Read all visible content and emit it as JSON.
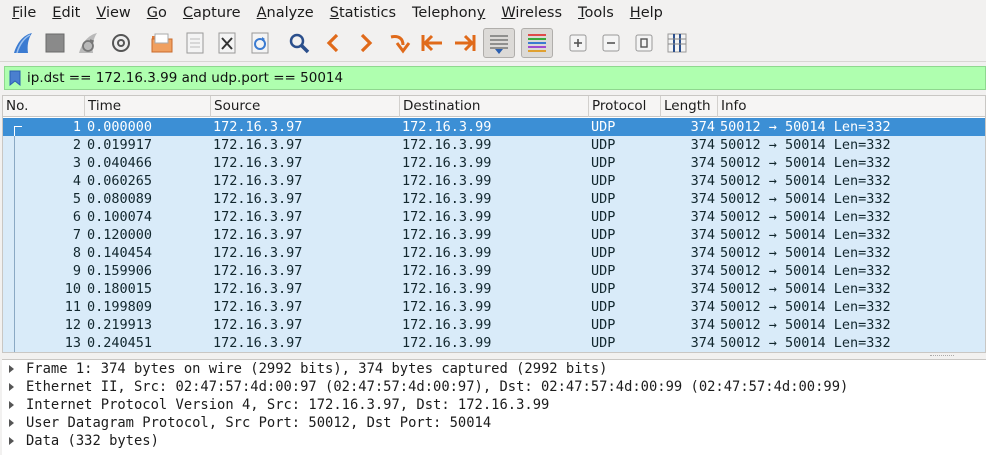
{
  "menu": [
    {
      "mnemonic": "F",
      "rest": "ile"
    },
    {
      "mnemonic": "E",
      "rest": "dit"
    },
    {
      "mnemonic": "V",
      "rest": "iew"
    },
    {
      "mnemonic": "G",
      "rest": "o"
    },
    {
      "mnemonic": "C",
      "rest": "apture"
    },
    {
      "mnemonic": "A",
      "rest": "nalyze"
    },
    {
      "mnemonic": "S",
      "rest": "tatistics"
    },
    {
      "pre": "Telephon",
      "mnemonic": "y",
      "rest": ""
    },
    {
      "mnemonic": "W",
      "rest": "ireless"
    },
    {
      "mnemonic": "T",
      "rest": "ools"
    },
    {
      "mnemonic": "H",
      "rest": "elp"
    }
  ],
  "toolbar_icons": [
    "shark-fin-start-icon",
    "stop-square-icon",
    "restart-fin-icon",
    "capture-options-gear-icon",
    "open-folder-icon",
    "save-file-icon",
    "close-file-icon",
    "reload-icon",
    "find-magnifier-icon",
    "go-back-arrow-icon",
    "go-forward-arrow-icon",
    "go-to-packet-icon",
    "first-packet-icon",
    "last-packet-icon",
    "autoscroll-icon",
    "colorize-icon",
    "zoom-in-icon",
    "zoom-out-icon",
    "normal-size-icon",
    "resize-columns-icon"
  ],
  "filter": {
    "value": "ip.dst == 172.16.3.99 and udp.port == 50014"
  },
  "columns": [
    "No.",
    "Time",
    "Source",
    "Destination",
    "Protocol",
    "Length",
    "Info"
  ],
  "packets": [
    {
      "no": "1",
      "time": "0.000000",
      "src": "172.16.3.97",
      "dst": "172.16.3.99",
      "proto": "UDP",
      "len": "374",
      "info": "50012 → 50014 Len=332"
    },
    {
      "no": "2",
      "time": "0.019917",
      "src": "172.16.3.97",
      "dst": "172.16.3.99",
      "proto": "UDP",
      "len": "374",
      "info": "50012 → 50014 Len=332"
    },
    {
      "no": "3",
      "time": "0.040466",
      "src": "172.16.3.97",
      "dst": "172.16.3.99",
      "proto": "UDP",
      "len": "374",
      "info": "50012 → 50014 Len=332"
    },
    {
      "no": "4",
      "time": "0.060265",
      "src": "172.16.3.97",
      "dst": "172.16.3.99",
      "proto": "UDP",
      "len": "374",
      "info": "50012 → 50014 Len=332"
    },
    {
      "no": "5",
      "time": "0.080089",
      "src": "172.16.3.97",
      "dst": "172.16.3.99",
      "proto": "UDP",
      "len": "374",
      "info": "50012 → 50014 Len=332"
    },
    {
      "no": "6",
      "time": "0.100074",
      "src": "172.16.3.97",
      "dst": "172.16.3.99",
      "proto": "UDP",
      "len": "374",
      "info": "50012 → 50014 Len=332"
    },
    {
      "no": "7",
      "time": "0.120000",
      "src": "172.16.3.97",
      "dst": "172.16.3.99",
      "proto": "UDP",
      "len": "374",
      "info": "50012 → 50014 Len=332"
    },
    {
      "no": "8",
      "time": "0.140454",
      "src": "172.16.3.97",
      "dst": "172.16.3.99",
      "proto": "UDP",
      "len": "374",
      "info": "50012 → 50014 Len=332"
    },
    {
      "no": "9",
      "time": "0.159906",
      "src": "172.16.3.97",
      "dst": "172.16.3.99",
      "proto": "UDP",
      "len": "374",
      "info": "50012 → 50014 Len=332"
    },
    {
      "no": "10",
      "time": "0.180015",
      "src": "172.16.3.97",
      "dst": "172.16.3.99",
      "proto": "UDP",
      "len": "374",
      "info": "50012 → 50014 Len=332"
    },
    {
      "no": "11",
      "time": "0.199809",
      "src": "172.16.3.97",
      "dst": "172.16.3.99",
      "proto": "UDP",
      "len": "374",
      "info": "50012 → 50014 Len=332"
    },
    {
      "no": "12",
      "time": "0.219913",
      "src": "172.16.3.97",
      "dst": "172.16.3.99",
      "proto": "UDP",
      "len": "374",
      "info": "50012 → 50014 Len=332"
    },
    {
      "no": "13",
      "time": "0.240451",
      "src": "172.16.3.97",
      "dst": "172.16.3.99",
      "proto": "UDP",
      "len": "374",
      "info": "50012 → 50014 Len=332"
    }
  ],
  "selected_packet": "1",
  "details": [
    "Frame 1: 374 bytes on wire (2992 bits), 374 bytes captured (2992 bits)",
    "Ethernet II, Src: 02:47:57:4d:00:97 (02:47:57:4d:00:97), Dst: 02:47:57:4d:00:99 (02:47:57:4d:00:99)",
    "Internet Protocol Version 4, Src: 172.16.3.97, Dst: 172.16.3.99",
    "User Datagram Protocol, Src Port: 50012, Dst Port: 50014",
    "Data (332 bytes)"
  ],
  "colors": {
    "selected_row": "#3c8fd5",
    "udp_row": "#d9ebf9",
    "filter_valid": "#afffaf"
  }
}
